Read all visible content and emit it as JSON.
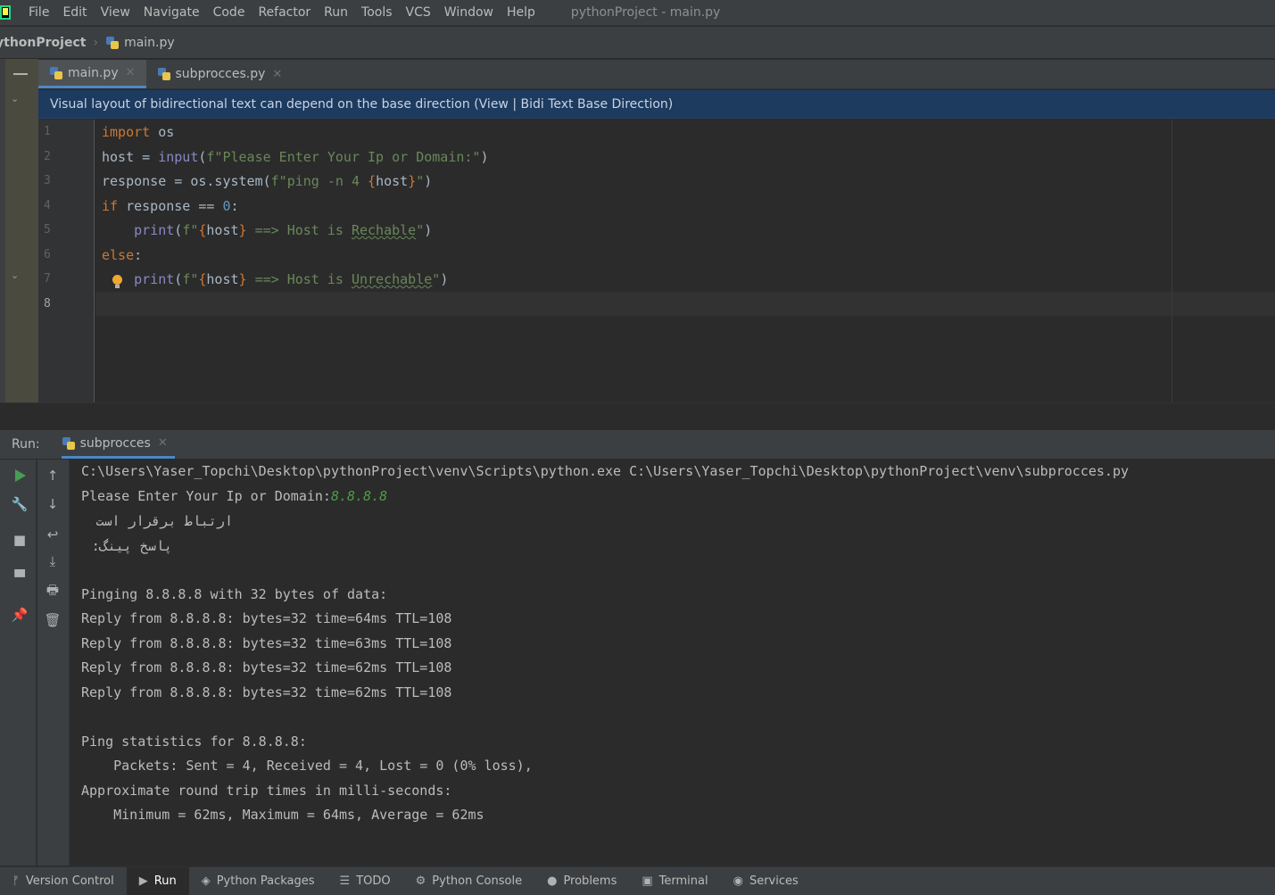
{
  "menu": {
    "items": [
      "File",
      "Edit",
      "View",
      "Navigate",
      "Code",
      "Refactor",
      "Run",
      "Tools",
      "VCS",
      "Window",
      "Help"
    ],
    "title": "pythonProject - main.py"
  },
  "breadcrumb": {
    "project": "ythonProject",
    "file": "main.py"
  },
  "editor_tabs": [
    {
      "label": "main.py",
      "active": true
    },
    {
      "label": "subprocces.py",
      "active": false
    }
  ],
  "notification": "Visual layout of bidirectional text can depend on the base direction (View | Bidi Text Base Direction)",
  "code": {
    "line_numbers": [
      "1",
      "2",
      "3",
      "4",
      "5",
      "6",
      "7",
      "8"
    ],
    "l1": {
      "kw": "import",
      "rest": " os"
    },
    "l2": {
      "a": "host = ",
      "fn": "input",
      "b": "(",
      "s1": "f\"Please Enter Your Ip or Domain:\"",
      "c": ")"
    },
    "l3": {
      "a": "response = os.system(",
      "s1": "f\"ping -n 4 ",
      "br1": "{",
      "v": "host",
      "br2": "}",
      "s2": "\"",
      "c": ")"
    },
    "l4": {
      "kw": "if",
      "a": " response == ",
      "num": "0",
      "b": ":"
    },
    "l5": {
      "indent": "    ",
      "fn": "print",
      "a": "(",
      "s1": "f\"",
      "br1": "{",
      "v": "host",
      "br2": "}",
      "s2": " ==> Host is ",
      "typo": "Rechable",
      "s3": "\"",
      "c": ")"
    },
    "l6": {
      "kw": "else",
      "b": ":"
    },
    "l7": {
      "indent": "    ",
      "fn": "print",
      "a": "(",
      "s1": "f\"",
      "br1": "{",
      "v": "host",
      "br2": "}",
      "s2": " ==> Host is ",
      "typo": "Unrechable",
      "s3": "\"",
      "c": ")"
    }
  },
  "run": {
    "label": "Run:",
    "tab": "subprocces",
    "console": {
      "cmd": "C:\\Users\\Yaser_Topchi\\Desktop\\pythonProject\\venv\\Scripts\\python.exe C:\\Users\\Yaser_Topchi\\Desktop\\pythonProject\\venv\\subprocces.py",
      "prompt": "Please Enter Your Ip or Domain:",
      "input": "8.8.8.8",
      "fa1": "ارتباط برقرار است",
      "fa2": "پاسخ پینگ:",
      "pinging": "Pinging 8.8.8.8 with 32 bytes of data:",
      "reply1": "Reply from 8.8.8.8: bytes=32 time=64ms TTL=108",
      "reply2": "Reply from 8.8.8.8: bytes=32 time=63ms TTL=108",
      "reply3": "Reply from 8.8.8.8: bytes=32 time=62ms TTL=108",
      "reply4": "Reply from 8.8.8.8: bytes=32 time=62ms TTL=108",
      "stats_title": "Ping statistics for 8.8.8.8:",
      "packets": "    Packets: Sent = 4, Received = 4, Lost = 0 (0% loss),",
      "rtt_title": "Approximate round trip times in milli-seconds:",
      "rtt": "    Minimum = 62ms, Maximum = 64ms, Average = 62ms"
    }
  },
  "status": {
    "version_control": "Version Control",
    "run": "Run",
    "python_packages": "Python Packages",
    "todo": "TODO",
    "python_console": "Python Console",
    "problems": "Problems",
    "terminal": "Terminal",
    "services": "Services"
  },
  "colors": {
    "keyword": "#cc7832",
    "string": "#6a8759",
    "builtin": "#8888c6",
    "number": "#6897bb",
    "accent": "#4a88c7"
  }
}
